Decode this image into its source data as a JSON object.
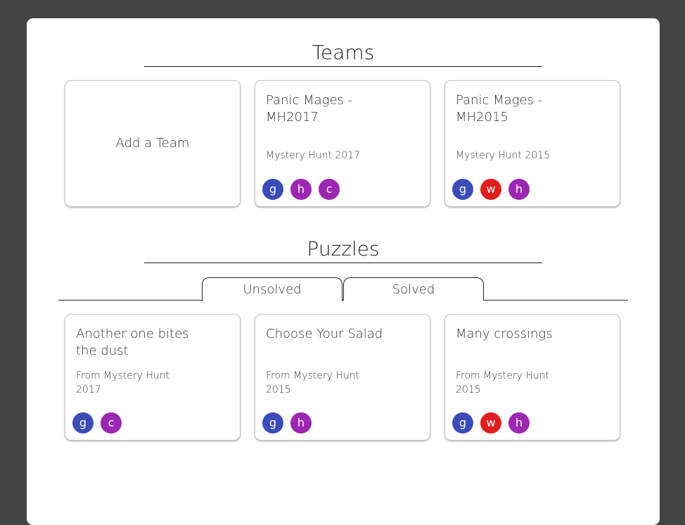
{
  "teams_section": {
    "title": "Teams",
    "add_label": "Add a Team",
    "teams": [
      {
        "name": "Panic Mages - MH2017",
        "hunt": "Mystery Hunt 2017",
        "members": [
          {
            "letter": "g",
            "color": "#3b4cb8"
          },
          {
            "letter": "h",
            "color": "#9c27b0"
          },
          {
            "letter": "c",
            "color": "#9c27b0"
          }
        ]
      },
      {
        "name": "Panic Mages - MH2015",
        "hunt": "Mystery Hunt 2015",
        "members": [
          {
            "letter": "g",
            "color": "#3b4cb8"
          },
          {
            "letter": "w",
            "color": "#e01e1e"
          },
          {
            "letter": "h",
            "color": "#9c27b0"
          }
        ]
      }
    ]
  },
  "puzzles_section": {
    "title": "Puzzles",
    "tabs": [
      {
        "label": "Unsolved",
        "active": true
      },
      {
        "label": "Solved",
        "active": false
      }
    ],
    "puzzles": [
      {
        "name": "Another one bites the dust",
        "source": "From Mystery Hunt 2017",
        "members": [
          {
            "letter": "g",
            "color": "#3b4cb8"
          },
          {
            "letter": "c",
            "color": "#9c27b0"
          }
        ]
      },
      {
        "name": "Choose Your Salad",
        "source": "From Mystery Hunt 2015",
        "members": [
          {
            "letter": "g",
            "color": "#3b4cb8"
          },
          {
            "letter": "h",
            "color": "#9c27b0"
          }
        ]
      },
      {
        "name": "Many crossings",
        "source": "From Mystery Hunt 2015",
        "members": [
          {
            "letter": "g",
            "color": "#3b4cb8"
          },
          {
            "letter": "w",
            "color": "#e01e1e"
          },
          {
            "letter": "h",
            "color": "#9c27b0"
          }
        ]
      }
    ]
  }
}
